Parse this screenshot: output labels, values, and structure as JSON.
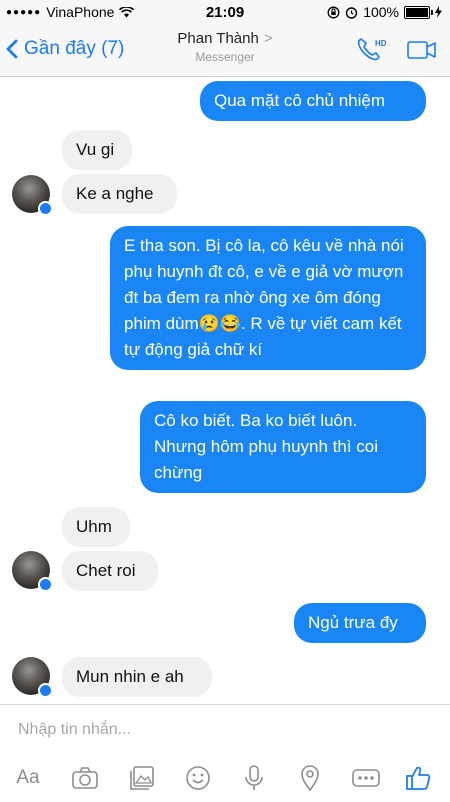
{
  "status_bar": {
    "carrier": "VinaPhone",
    "signal_dots": "●●●●●",
    "time": "21:09",
    "battery": "100%",
    "battery_level": 1.0
  },
  "nav": {
    "back_label": "Gần đây (7)",
    "contact_name": "Phan Thành",
    "chevron": ">",
    "subtitle": "Messenger",
    "hd_label": "HD"
  },
  "messages": [
    {
      "dir": "out",
      "text": "Qua mặt cô chủ nhiệm"
    },
    {
      "dir": "in",
      "text": "Vu gi"
    },
    {
      "dir": "in",
      "text": "Ke a nghe"
    },
    {
      "dir": "out",
      "text": "E tha son. Bị cô la, cô kêu về nhà nói phụ huynh đt cô, e về e giả vờ mượn đt ba đem ra nhờ ông xe ôm đóng phim dùm😢😂. R về tự viết cam kết tự động giả chữ kí"
    },
    {
      "dir": "out",
      "text": "Cô ko biết. Ba ko biết luôn. Nhưng hôm phụ huynh thì coi chừng"
    },
    {
      "dir": "in",
      "text": "Uhm"
    },
    {
      "dir": "in",
      "text": "Chet roi"
    },
    {
      "dir": "out",
      "text": "Ngủ trưa đy"
    },
    {
      "dir": "in",
      "text": "Mun nhin e ah"
    }
  ],
  "composer": {
    "placeholder": "Nhập tin nhắn...",
    "aa_label": "Aa",
    "tools": [
      "text-format-icon",
      "camera-icon",
      "photo-icon",
      "sticker-icon",
      "microphone-icon",
      "location-icon",
      "more-icon",
      "like-icon"
    ]
  },
  "colors": {
    "accent": "#1c7cf4",
    "outgoing_bubble": "#1a86f5",
    "incoming_bubble": "#f1f0f0"
  }
}
